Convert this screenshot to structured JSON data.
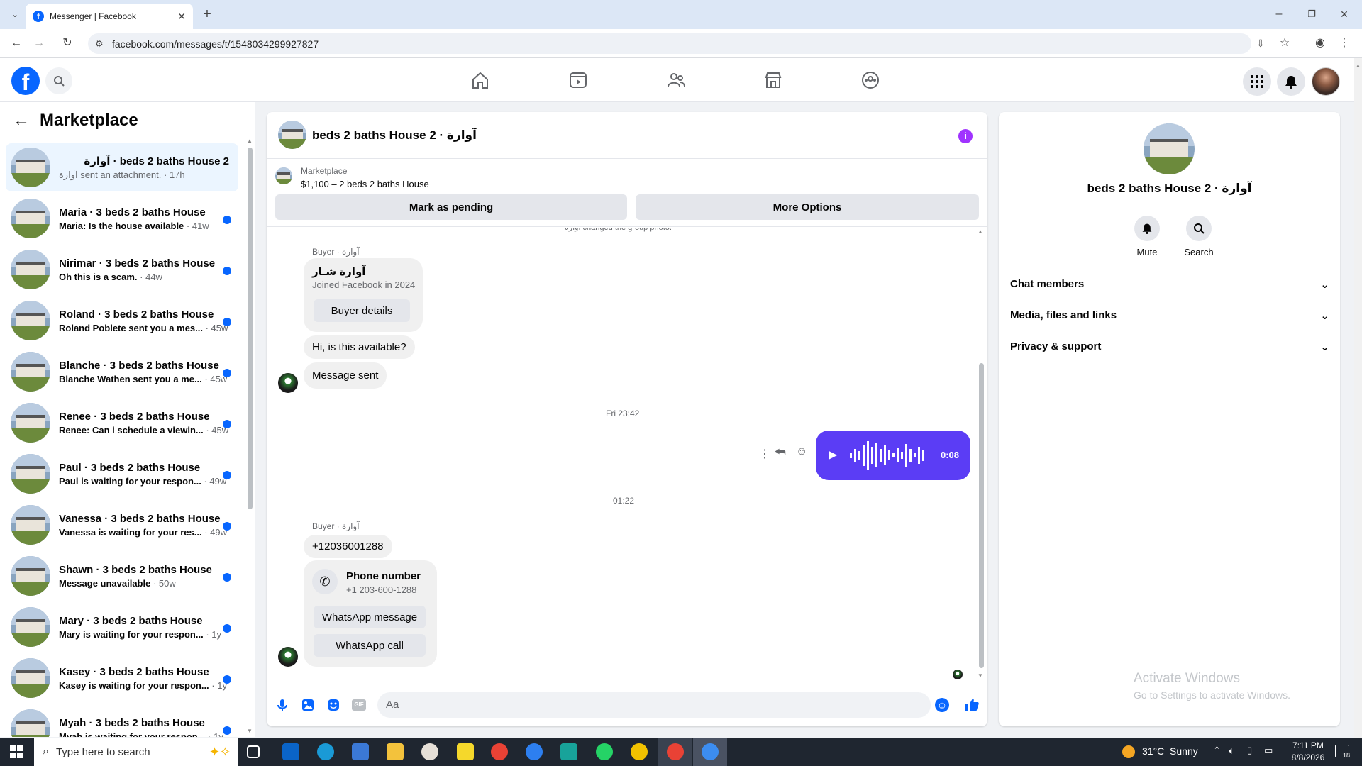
{
  "browser": {
    "tab_title": "Messenger | Facebook",
    "url": "facebook.com/messages/t/1548034299927827"
  },
  "sidebar": {
    "title": "Marketplace",
    "items": [
      {
        "name": "beds 2 baths House 2 · آوارة",
        "msg": "آوارة sent an attachment.",
        "ago": " · 17h",
        "unread": false
      },
      {
        "name": "Maria · 3 beds 2 baths House",
        "msg": "Maria: Is the house available",
        "ago": " · 41w",
        "unread": true
      },
      {
        "name": "Nirimar · 3 beds 2 baths House",
        "msg": "Oh this is a scam.",
        "ago": " · 44w",
        "unread": true
      },
      {
        "name": "Roland · 3 beds 2 baths House",
        "msg": "Roland Poblete sent you a mes...",
        "ago": " · 45w",
        "unread": true
      },
      {
        "name": "Blanche · 3 beds 2 baths House",
        "msg": "Blanche Wathen sent you a me...",
        "ago": " · 45w",
        "unread": true
      },
      {
        "name": "Renee · 3 beds 2 baths House",
        "msg": "Renee: Can i schedule a viewin...",
        "ago": " · 45w",
        "unread": true
      },
      {
        "name": "Paul · 3 beds 2 baths House",
        "msg": "Paul is waiting for your respon...",
        "ago": " · 49w",
        "unread": true
      },
      {
        "name": "Vanessa · 3 beds 2 baths House",
        "msg": "Vanessa is waiting for your res...",
        "ago": " · 49w",
        "unread": true
      },
      {
        "name": "Shawn · 3 beds 2 baths House",
        "msg": "Message unavailable",
        "ago": " · 50w",
        "unread": true
      },
      {
        "name": "Mary · 3 beds 2 baths House",
        "msg": "Mary is waiting for your respon...",
        "ago": " · 1y",
        "unread": true
      },
      {
        "name": "Kasey · 3 beds 2 baths House",
        "msg": "Kasey is waiting for your respon...",
        "ago": " · 1y",
        "unread": true
      },
      {
        "name": "Myah · 3 beds 2 baths House",
        "msg": "Myah is waiting for your respon...",
        "ago": " · 1y",
        "unread": true
      }
    ]
  },
  "chat": {
    "title": "beds 2 baths House 2 · آوارة",
    "listing_source": "Marketplace",
    "listing_desc": "$1,100 – 2 beds 2 baths House",
    "mark_pending": "Mark as pending",
    "more_options": "More Options",
    "system_msg": "آوارة changed the group photo.",
    "buyer_label": "Buyer · آوارة",
    "buyer_name": "آوارة شـار",
    "buyer_joined": "Joined Facebook in 2024",
    "buyer_details": "Buyer details",
    "msg_available": "Hi, is this available?",
    "msg_sent": "Message sent",
    "time1": "Fri 23:42",
    "voice_duration": "0:08",
    "time2": "01:22",
    "buyer_label2": "Buyer · آوارة",
    "phone_msg": "+12036001288",
    "phone_title": "Phone number",
    "phone_formatted": "+1 203-600-1288",
    "whatsapp_message": "WhatsApp message",
    "whatsapp_call": "WhatsApp call",
    "input_placeholder": "Aa",
    "gif_label": "GIF"
  },
  "info": {
    "title": "beds 2 baths House 2 · آوارة",
    "mute": "Mute",
    "search": "Search",
    "sections": [
      "Chat members",
      "Media, files and links",
      "Privacy & support"
    ],
    "activate_title": "Activate Windows",
    "activate_sub": "Go to Settings to activate Windows."
  },
  "taskbar": {
    "search_placeholder": "Type here to search",
    "weather": "31°C  Sunny",
    "time": "7:11 PM",
    "date": "8/8/2026",
    "notif_count": "18"
  },
  "colors": {
    "fb_blue": "#0866ff",
    "voice_bubble": "#5b3df5",
    "info_dot": "#a033ff"
  }
}
